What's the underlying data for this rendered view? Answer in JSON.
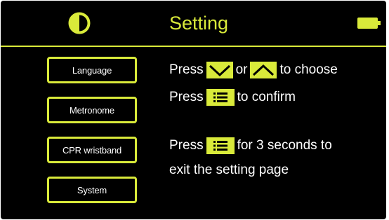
{
  "header": {
    "title": "Setting",
    "left_icon": "contrast-icon",
    "right_icon": "battery-icon"
  },
  "menu": {
    "items": [
      {
        "label": "Language"
      },
      {
        "label": "Metronome"
      },
      {
        "label": "CPR wristband"
      },
      {
        "label": "System"
      }
    ]
  },
  "instructions": {
    "line1": {
      "press": "Press",
      "or": "or",
      "end": "to choose"
    },
    "line2": {
      "press": "Press",
      "end": "to confirm"
    },
    "line3": {
      "press": "Press",
      "end": "for 3 seconds to"
    },
    "line4": {
      "text": "exit the setting page"
    }
  },
  "icons": {
    "down": "chevron-down-icon",
    "up": "chevron-up-icon",
    "menu": "menu-list-icon"
  },
  "colors": {
    "accent": "#d9ea3a",
    "background": "#000000",
    "text": "#ffffff"
  }
}
